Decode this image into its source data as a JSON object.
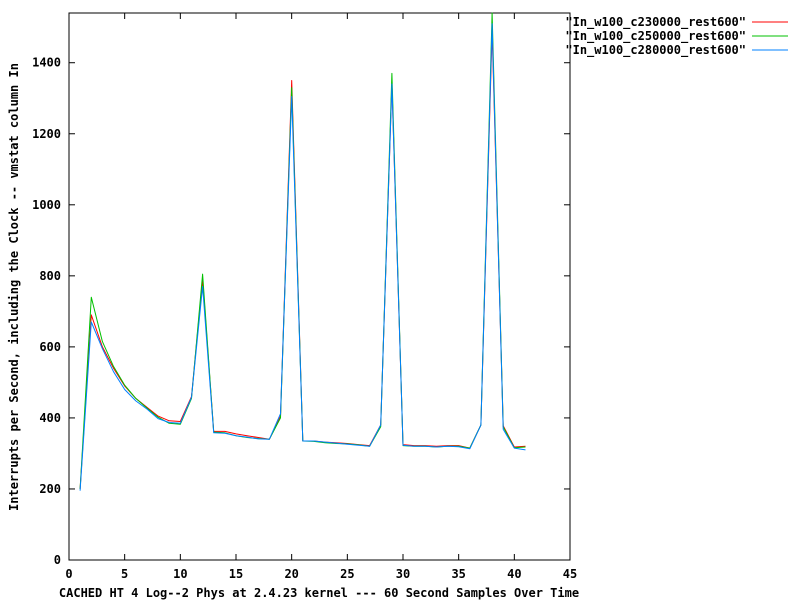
{
  "chart_data": {
    "type": "line",
    "title": "",
    "xlabel": "CACHED HT 4 Log--2 Phys at 2.4.23 kernel --- 60 Second Samples Over Time",
    "ylabel": "Interrupts per Second, including the Clock -- vmstat column In",
    "xlim": [
      0,
      45
    ],
    "ylim": [
      0,
      1540
    ],
    "x_ticks": [
      0,
      5,
      10,
      15,
      20,
      25,
      30,
      35,
      40,
      45
    ],
    "y_ticks": [
      0,
      200,
      400,
      600,
      800,
      1000,
      1200,
      1400
    ],
    "grid": false,
    "legend_position": "top-right",
    "x": [
      1,
      2,
      3,
      4,
      5,
      6,
      7,
      8,
      9,
      10,
      11,
      12,
      13,
      14,
      15,
      16,
      17,
      18,
      19,
      20,
      21,
      22,
      23,
      24,
      25,
      26,
      27,
      28,
      29,
      30,
      31,
      32,
      33,
      34,
      35,
      36,
      37,
      38,
      39,
      40,
      41,
      42,
      43,
      44,
      45
    ],
    "series": [
      {
        "name": "\"In_w100_c230000_rest600\"",
        "color": "#ff0000",
        "values": [
          200,
          690,
          600,
          540,
          490,
          455,
          430,
          405,
          392,
          390,
          460,
          790,
          362,
          362,
          355,
          350,
          345,
          340,
          405,
          1350,
          335,
          335,
          332,
          330,
          328,
          325,
          322,
          380,
          1340,
          325,
          322,
          322,
          320,
          322,
          322,
          315,
          380,
          1490,
          378,
          318,
          320
        ]
      },
      {
        "name": "\"In_w100_c250000_rest600\"",
        "color": "#00c000",
        "values": [
          200,
          740,
          615,
          545,
          492,
          455,
          428,
          402,
          385,
          382,
          455,
          805,
          360,
          358,
          350,
          345,
          342,
          340,
          400,
          1330,
          335,
          334,
          330,
          328,
          327,
          324,
          320,
          375,
          1370,
          322,
          320,
          320,
          318,
          320,
          320,
          315,
          380,
          1540,
          375,
          316,
          318
        ]
      },
      {
        "name": "\"In_w100_c280000_rest600\"",
        "color": "#0080ff",
        "values": [
          195,
          670,
          595,
          530,
          480,
          448,
          425,
          398,
          387,
          385,
          458,
          770,
          358,
          357,
          350,
          346,
          341,
          340,
          412,
          1305,
          335,
          335,
          332,
          329,
          326,
          323,
          320,
          380,
          1340,
          323,
          320,
          320,
          318,
          320,
          319,
          313,
          380,
          1510,
          368,
          315,
          310
        ]
      }
    ]
  }
}
